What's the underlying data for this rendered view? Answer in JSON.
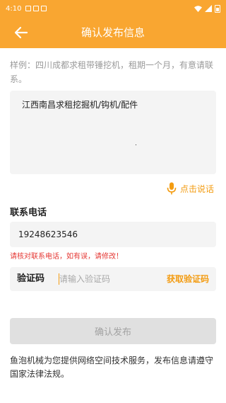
{
  "status_bar": {
    "time": "4:10"
  },
  "header": {
    "title": "确认发布信息",
    "back_icon": "arrow-left-icon"
  },
  "example": {
    "text": "样例：四川成都求租带锤挖机，租期一个月，有意请联系。"
  },
  "description": {
    "value": "江西南昌求租挖掘机/钩机/配件"
  },
  "voice": {
    "label": "点击说话",
    "icon": "microphone-icon"
  },
  "phone": {
    "heading": "联系电话",
    "value": "19248623546",
    "warning": "请核对联系电话，如有误，请修改！"
  },
  "verification": {
    "label": "验证码",
    "placeholder": "请输入验证码",
    "get_code_label": "获取验证码"
  },
  "submit": {
    "label": "确认发布"
  },
  "footer": {
    "notice": "鱼泡机械为您提供网络空间技术服务，发布信息请遵守国家法律法规。"
  },
  "colors": {
    "accent": "#f9a631",
    "link": "#f39c12",
    "warning": "#e53935"
  }
}
